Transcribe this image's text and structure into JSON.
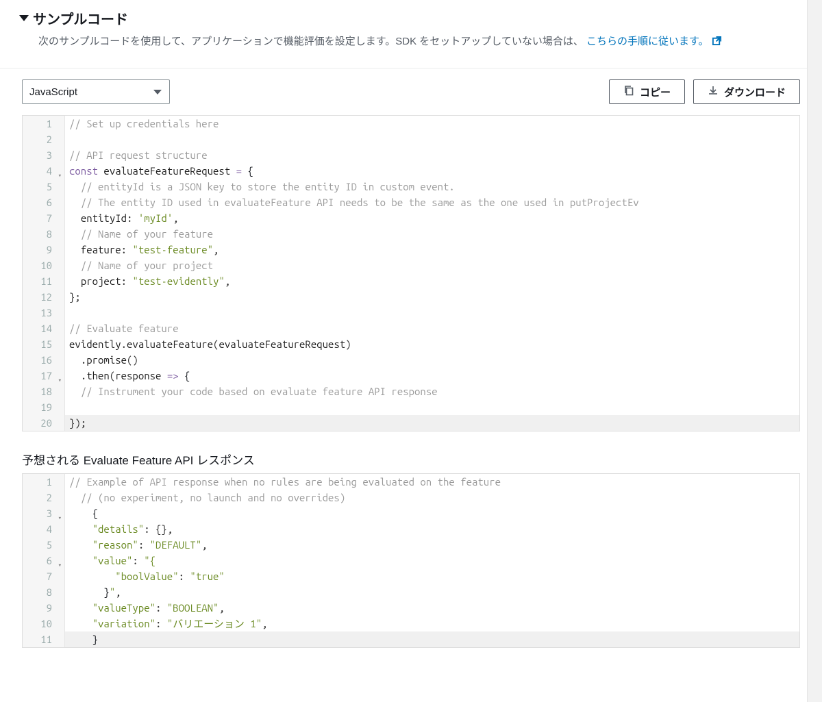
{
  "header": {
    "title": "サンプルコード",
    "subtitle_prefix": "次のサンプルコードを使用して、アプリケーションで機能評価を設定します。SDK をセットアップしていない場合は、",
    "link_text": "こちらの手順に従います。"
  },
  "toolbar": {
    "language_selected": "JavaScript",
    "language_options": [
      "JavaScript"
    ],
    "copy_label": "コピー",
    "download_label": "ダウンロード"
  },
  "code1": {
    "lines": [
      {
        "n": 1,
        "fold": false,
        "seg": [
          {
            "c": "com",
            "t": "// Set up credentials here"
          }
        ]
      },
      {
        "n": 2,
        "fold": false,
        "seg": [
          {
            "c": "",
            "t": ""
          }
        ]
      },
      {
        "n": 3,
        "fold": false,
        "seg": [
          {
            "c": "com",
            "t": "// API request structure"
          }
        ]
      },
      {
        "n": 4,
        "fold": true,
        "seg": [
          {
            "c": "kw",
            "t": "const"
          },
          {
            "c": "",
            "t": " "
          },
          {
            "c": "id",
            "t": "evaluateFeatureRequest"
          },
          {
            "c": "",
            "t": " "
          },
          {
            "c": "op",
            "t": "="
          },
          {
            "c": "",
            "t": " {"
          }
        ]
      },
      {
        "n": 5,
        "fold": false,
        "seg": [
          {
            "c": "",
            "t": "  "
          },
          {
            "c": "com",
            "t": "// entityId is a JSON key to store the entity ID in custom event."
          }
        ]
      },
      {
        "n": 6,
        "fold": false,
        "seg": [
          {
            "c": "",
            "t": "  "
          },
          {
            "c": "com",
            "t": "// The entity ID used in evaluateFeature API needs to be the same as the one used in putProjectEv"
          }
        ]
      },
      {
        "n": 7,
        "fold": false,
        "seg": [
          {
            "c": "",
            "t": "  "
          },
          {
            "c": "prop",
            "t": "entityId"
          },
          {
            "c": "punc",
            "t": ": "
          },
          {
            "c": "str",
            "t": "'myId'"
          },
          {
            "c": "punc",
            "t": ","
          }
        ]
      },
      {
        "n": 8,
        "fold": false,
        "seg": [
          {
            "c": "",
            "t": "  "
          },
          {
            "c": "com",
            "t": "// Name of your feature"
          }
        ]
      },
      {
        "n": 9,
        "fold": false,
        "seg": [
          {
            "c": "",
            "t": "  "
          },
          {
            "c": "prop",
            "t": "feature"
          },
          {
            "c": "punc",
            "t": ": "
          },
          {
            "c": "str",
            "t": "\"test-feature\""
          },
          {
            "c": "punc",
            "t": ","
          }
        ]
      },
      {
        "n": 10,
        "fold": false,
        "seg": [
          {
            "c": "",
            "t": "  "
          },
          {
            "c": "com",
            "t": "// Name of your project"
          }
        ]
      },
      {
        "n": 11,
        "fold": false,
        "seg": [
          {
            "c": "",
            "t": "  "
          },
          {
            "c": "prop",
            "t": "project"
          },
          {
            "c": "punc",
            "t": ": "
          },
          {
            "c": "str",
            "t": "\"test-evidently\""
          },
          {
            "c": "punc",
            "t": ","
          }
        ]
      },
      {
        "n": 12,
        "fold": false,
        "seg": [
          {
            "c": "punc",
            "t": "};"
          }
        ]
      },
      {
        "n": 13,
        "fold": false,
        "seg": [
          {
            "c": "",
            "t": ""
          }
        ]
      },
      {
        "n": 14,
        "fold": false,
        "seg": [
          {
            "c": "com",
            "t": "// Evaluate feature"
          }
        ]
      },
      {
        "n": 15,
        "fold": false,
        "seg": [
          {
            "c": "id",
            "t": "evidently"
          },
          {
            "c": "punc",
            "t": "."
          },
          {
            "c": "id",
            "t": "evaluateFeature"
          },
          {
            "c": "punc",
            "t": "("
          },
          {
            "c": "id",
            "t": "evaluateFeatureRequest"
          },
          {
            "c": "punc",
            "t": ")"
          }
        ]
      },
      {
        "n": 16,
        "fold": false,
        "seg": [
          {
            "c": "",
            "t": "  "
          },
          {
            "c": "punc",
            "t": "."
          },
          {
            "c": "id",
            "t": "promise"
          },
          {
            "c": "punc",
            "t": "()"
          }
        ]
      },
      {
        "n": 17,
        "fold": true,
        "seg": [
          {
            "c": "",
            "t": "  "
          },
          {
            "c": "punc",
            "t": "."
          },
          {
            "c": "id",
            "t": "then"
          },
          {
            "c": "punc",
            "t": "("
          },
          {
            "c": "id",
            "t": "response"
          },
          {
            "c": "",
            "t": " "
          },
          {
            "c": "op",
            "t": "=>"
          },
          {
            "c": "",
            "t": " {"
          }
        ]
      },
      {
        "n": 18,
        "fold": false,
        "seg": [
          {
            "c": "",
            "t": "  "
          },
          {
            "c": "com",
            "t": "// Instrument your code based on evaluate feature API response"
          }
        ]
      },
      {
        "n": 19,
        "fold": false,
        "seg": [
          {
            "c": "",
            "t": ""
          }
        ]
      },
      {
        "n": 20,
        "fold": false,
        "hl": true,
        "seg": [
          {
            "c": "punc",
            "t": "});"
          }
        ]
      }
    ]
  },
  "subsection": {
    "title": "予想される Evaluate Feature API レスポンス"
  },
  "code2": {
    "lines": [
      {
        "n": 1,
        "fold": false,
        "seg": [
          {
            "c": "com",
            "t": "// Example of API response when no rules are being evaluated on the feature"
          }
        ]
      },
      {
        "n": 2,
        "fold": false,
        "seg": [
          {
            "c": "",
            "t": "  "
          },
          {
            "c": "com",
            "t": "// (no experiment, no launch and no overrides)"
          }
        ]
      },
      {
        "n": 3,
        "fold": true,
        "seg": [
          {
            "c": "",
            "t": "    {"
          }
        ]
      },
      {
        "n": 4,
        "fold": false,
        "seg": [
          {
            "c": "",
            "t": "    "
          },
          {
            "c": "str",
            "t": "\"details\""
          },
          {
            "c": "punc",
            "t": ": {},"
          }
        ]
      },
      {
        "n": 5,
        "fold": false,
        "seg": [
          {
            "c": "",
            "t": "    "
          },
          {
            "c": "str",
            "t": "\"reason\""
          },
          {
            "c": "punc",
            "t": ": "
          },
          {
            "c": "str",
            "t": "\"DEFAULT\""
          },
          {
            "c": "punc",
            "t": ","
          }
        ]
      },
      {
        "n": 6,
        "fold": true,
        "seg": [
          {
            "c": "",
            "t": "    "
          },
          {
            "c": "str",
            "t": "\"value\""
          },
          {
            "c": "punc",
            "t": ": "
          },
          {
            "c": "str",
            "t": "\"{"
          }
        ]
      },
      {
        "n": 7,
        "fold": false,
        "seg": [
          {
            "c": "",
            "t": "        "
          },
          {
            "c": "str",
            "t": "\"boolValue\""
          },
          {
            "c": "punc",
            "t": ": "
          },
          {
            "c": "str",
            "t": "\"true\""
          }
        ]
      },
      {
        "n": 8,
        "fold": false,
        "seg": [
          {
            "c": "",
            "t": "      }"
          },
          {
            "c": "str",
            "t": "\""
          },
          {
            "c": "punc",
            "t": ","
          }
        ]
      },
      {
        "n": 9,
        "fold": false,
        "seg": [
          {
            "c": "",
            "t": "    "
          },
          {
            "c": "str",
            "t": "\"valueType\""
          },
          {
            "c": "punc",
            "t": ": "
          },
          {
            "c": "str",
            "t": "\"BOOLEAN\""
          },
          {
            "c": "punc",
            "t": ","
          }
        ]
      },
      {
        "n": 10,
        "fold": false,
        "seg": [
          {
            "c": "",
            "t": "    "
          },
          {
            "c": "str",
            "t": "\"variation\""
          },
          {
            "c": "punc",
            "t": ": "
          },
          {
            "c": "str",
            "t": "\"バリエーション 1\""
          },
          {
            "c": "punc",
            "t": ","
          }
        ]
      },
      {
        "n": 11,
        "fold": false,
        "hl": true,
        "seg": [
          {
            "c": "",
            "t": "    }"
          }
        ]
      }
    ]
  }
}
